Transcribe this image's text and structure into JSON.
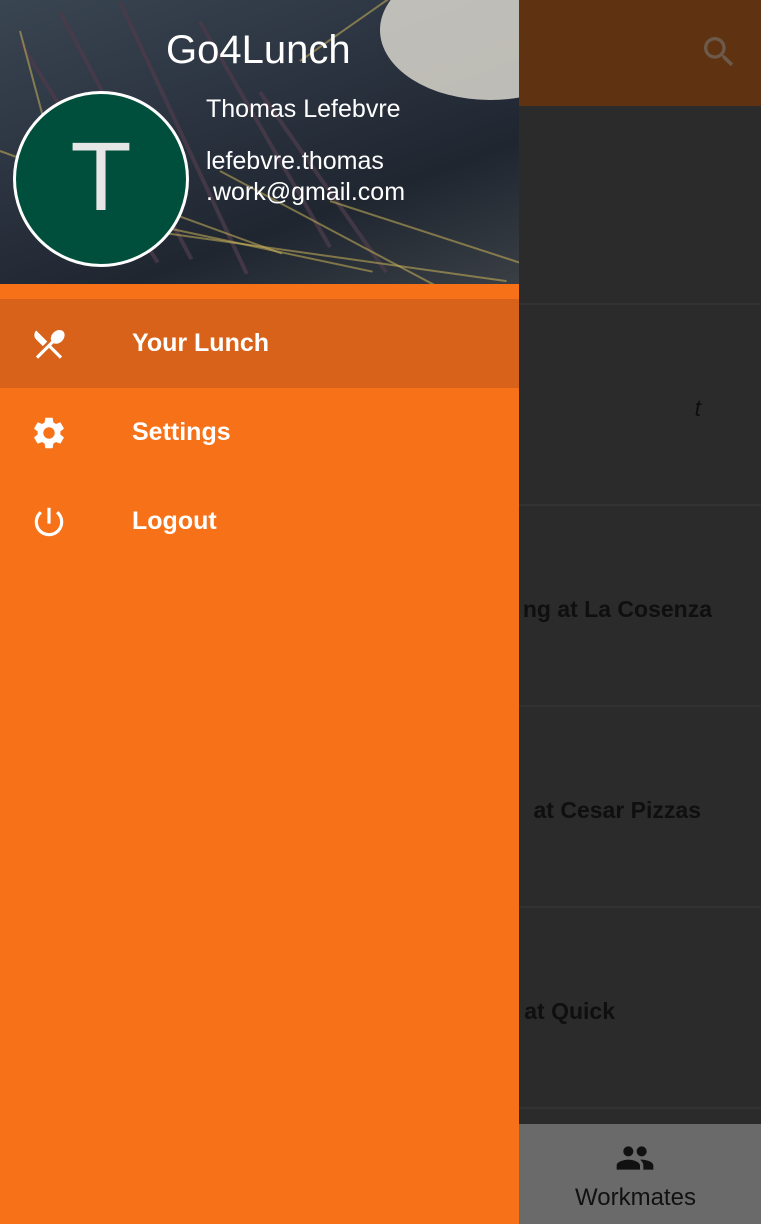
{
  "background": {
    "list_fragments": [
      {
        "text": "",
        "italic": false
      },
      {
        "text": "t",
        "italic": true
      },
      {
        "text": "ng at La Cosenza",
        "italic": false
      },
      {
        "text": "at Cesar Pizzas",
        "italic": false
      },
      {
        "text": "at Quick",
        "italic": false
      }
    ],
    "bottom_nav": {
      "workmates_label": "Workmates",
      "icon": "people-icon"
    },
    "search_icon": "search-icon"
  },
  "drawer": {
    "app_title": "Go4Lunch",
    "user": {
      "initial": "T",
      "name": "Thomas Lefebvre",
      "email": "lefebvre.thomas.work@gmail.com",
      "email_line1": "lefebvre.thomas",
      "email_line2": ".work@gmail.com"
    },
    "menu": [
      {
        "label": "Your Lunch",
        "icon": "utensils-icon",
        "active": true
      },
      {
        "label": "Settings",
        "icon": "gear-icon",
        "active": false
      },
      {
        "label": "Logout",
        "icon": "power-icon",
        "active": false
      }
    ]
  },
  "colors": {
    "drawer_orange": "#f77119",
    "active_item": "#d8621a",
    "avatar_green": "#004f3c",
    "app_bar_dimmed": "#5f3311"
  }
}
